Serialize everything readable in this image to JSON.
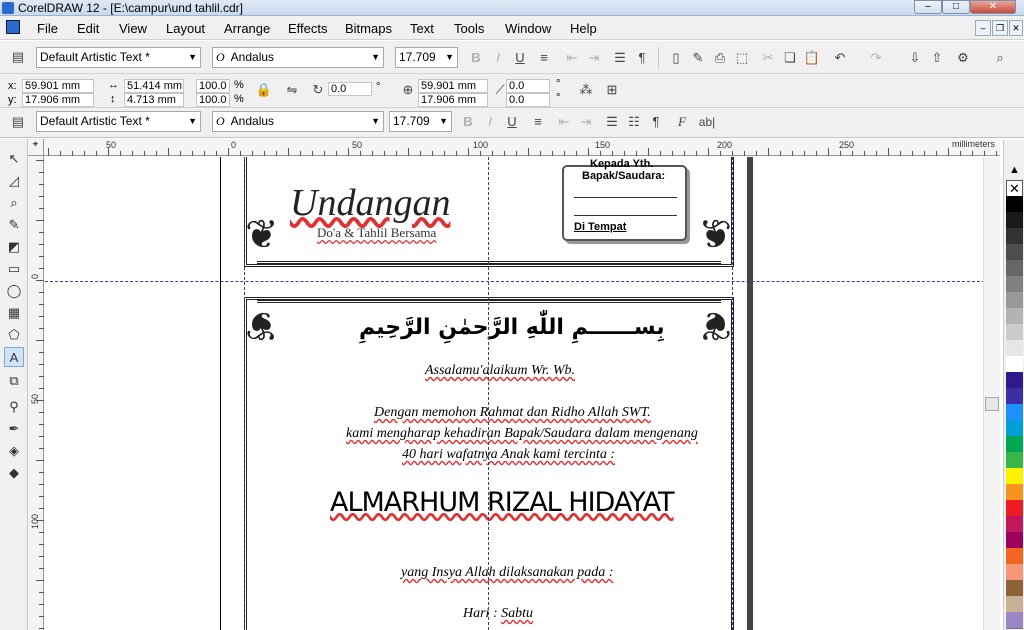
{
  "window": {
    "title": "CorelDRAW 12 - [E:\\campur\\und tahlil.cdr]"
  },
  "window_buttons": {
    "minimize": "–",
    "maximize": "□",
    "close": "✕"
  },
  "doc_buttons": {
    "minimize": "–",
    "restore": "❐",
    "close": "✕"
  },
  "menu": [
    "File",
    "Edit",
    "View",
    "Layout",
    "Arrange",
    "Effects",
    "Bitmaps",
    "Text",
    "Tools",
    "Window",
    "Help"
  ],
  "toolbar1": {
    "style_combo": "Default Artistic Text *",
    "font_combo": "Andalus",
    "size_combo": "17.709"
  },
  "toolbar2": {
    "x_label": "x:",
    "x_value": "59.901 mm",
    "y_label": "y:",
    "y_value": "17.906 mm",
    "w_value": "51.414 mm",
    "h_value": "4.713 mm",
    "scale_x": "100.0",
    "scale_y": "100.0",
    "pct": "%",
    "rotation": "0.0",
    "degree": "°",
    "cx_value": "59.901 mm",
    "cy_value": "17.906 mm",
    "skew_x": "0.0",
    "skew_y": "0.0"
  },
  "toolbar3": {
    "style_combo": "Default Artistic Text *",
    "font_combo": "Andalus",
    "size_combo": "17.709",
    "edit_text_icon": "ab|"
  },
  "ruler": {
    "units": "millimeters",
    "h_labels": [
      "50",
      "0",
      "50",
      "100",
      "150",
      "200",
      "250"
    ],
    "v_labels": [
      "0",
      "50",
      "100"
    ]
  },
  "document": {
    "heading": "Undangan",
    "subheading": "Do'a & Tahlil Bersama",
    "address_to": "Kepada Yth.",
    "address_salutation": "Bapak/Saudara:",
    "address_place": "Di Tempat",
    "arabic": "بِســــــمِ اللّٰهِ الرَّحمٰنِ الرَّحِيمِ",
    "greeting": "Assalamu'alaikum Wr. Wb.",
    "line1": "Dengan memohon Rahmat dan Ridho Allah SWT.",
    "line2": "kami mengharap kehadiran Bapak/Saudara dalam mengenang",
    "line3": "40 hari wafatnya Anak kami tercinta :",
    "name": "ALMARHUM RIZAL HIDAYAT",
    "line4": "yang Insya Allah dilaksanakan pada :",
    "day_label": "Hari",
    "day_sep": ":",
    "day_value": "Sabtu"
  },
  "palette_colors": [
    "#ffffff",
    "#000000",
    "#1a1a1a",
    "#333333",
    "#4d4d4d",
    "#666666",
    "#808080",
    "#999999",
    "#b3b3b3",
    "#cccccc",
    "#e6e6e6",
    "#ffffff",
    "#2e1a8c",
    "#3a2fa5",
    "#1e90ff",
    "#00a0d6",
    "#00a651",
    "#39b54a",
    "#fff200",
    "#f7941d",
    "#ed1c24",
    "#c2185b",
    "#9e005d",
    "#f26522",
    "#f7977a",
    "#8c6239",
    "#c7b299",
    "#9a86c7"
  ],
  "colors": {
    "accent": "#2a6ad0",
    "guide": "#3b3b8f"
  }
}
